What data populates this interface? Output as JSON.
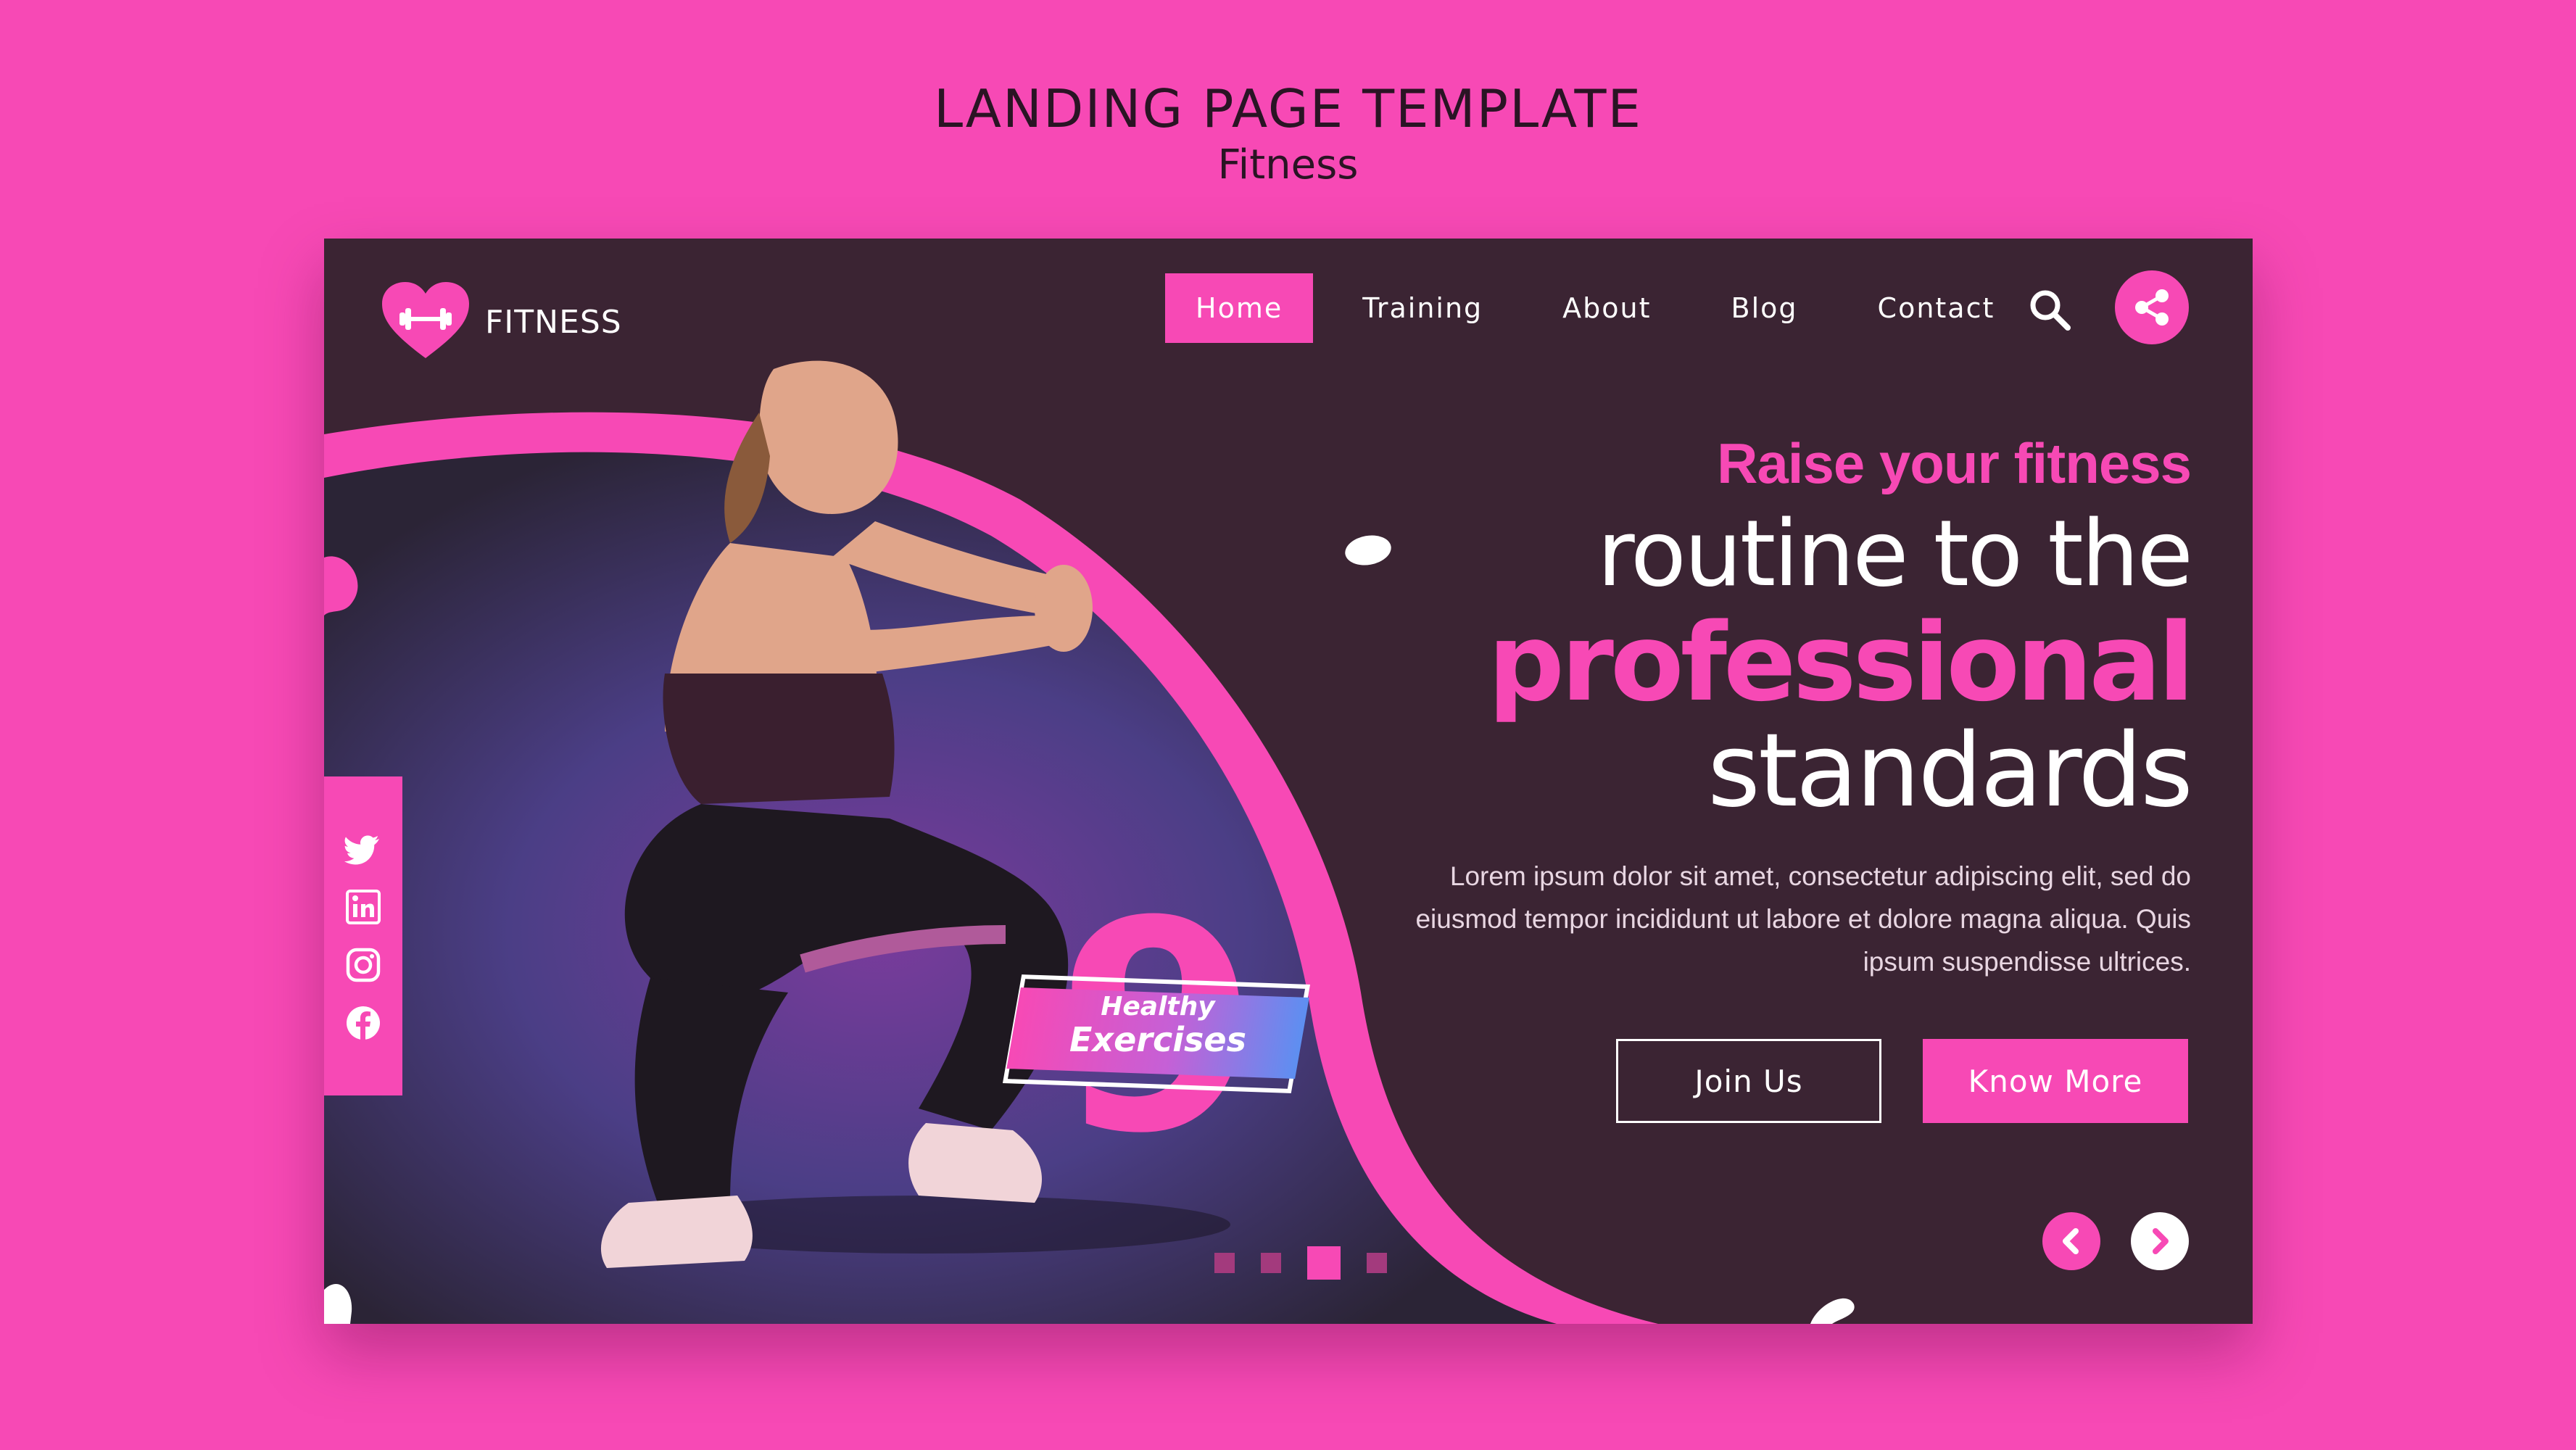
{
  "frame": {
    "title": "LANDING PAGE TEMPLATE",
    "subtitle": "Fitness"
  },
  "colors": {
    "page_background": "#f749b5",
    "card_background": "#3b2433",
    "accent": "#f749b5",
    "text_light": "#ffffff"
  },
  "brand": {
    "name": "FITNESS",
    "logo_icon": "heart-dumbbell-icon"
  },
  "nav": {
    "items": [
      {
        "label": "Home",
        "active": true
      },
      {
        "label": "Training",
        "active": false
      },
      {
        "label": "About",
        "active": false
      },
      {
        "label": "Blog",
        "active": false
      },
      {
        "label": "Contact",
        "active": false
      }
    ],
    "search_icon": "search-icon",
    "share_icon": "share-icon"
  },
  "hero": {
    "line1": "Raise your fitness",
    "line2": "routine to the",
    "line3": "professional",
    "line4": "standards",
    "description": "Lorem ipsum dolor sit amet, consectetur adipiscing elit, sed do eiusmod tempor incididunt ut labore et dolore magna aliqua. Quis ipsum suspendisse ultrices.",
    "primary_button": "Join Us",
    "secondary_button": "Know More"
  },
  "badge": {
    "number": "9",
    "line1": "Healthy",
    "line2": "Exercises"
  },
  "carousel": {
    "slide_count": 4,
    "active_index": 2,
    "prev_icon": "chevron-left-icon",
    "next_icon": "chevron-right-icon"
  },
  "social": [
    {
      "icon": "twitter-icon"
    },
    {
      "icon": "linkedin-icon"
    },
    {
      "icon": "instagram-icon"
    },
    {
      "icon": "facebook-icon"
    }
  ]
}
